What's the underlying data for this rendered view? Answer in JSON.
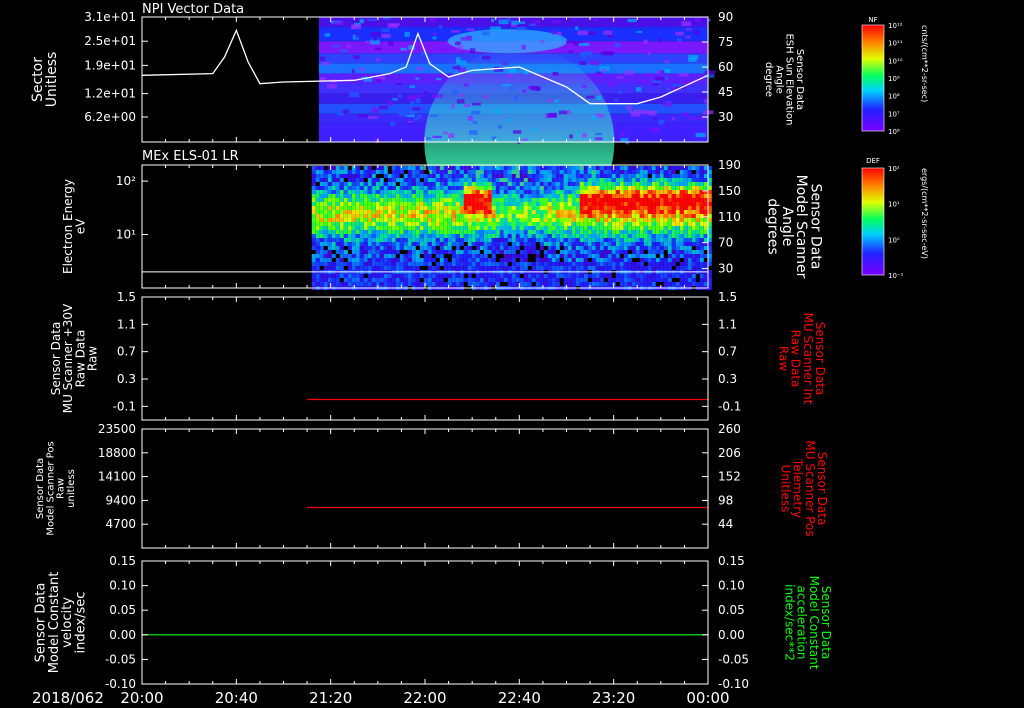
{
  "date_label": "2018/062",
  "time_ticks": [
    "20:00",
    "20:40",
    "21:20",
    "22:00",
    "22:40",
    "23:20",
    "00:00"
  ],
  "colorbars": [
    {
      "tag": "NF",
      "unit": "cnts/(cm**2-sr-sec)",
      "ticks": [
        "10⁸",
        "10⁷",
        "10⁸",
        "10⁹",
        "10¹⁰",
        "10¹¹",
        "10¹²"
      ]
    },
    {
      "tag": "DEF",
      "unit": "ergs/(cm**2-sr-sec-eV)",
      "ticks": [
        "10⁻¹",
        "10⁰",
        "10¹",
        "10²"
      ]
    }
  ],
  "chart_data": [
    {
      "type": "heatmap",
      "title": "NPI Vector Data",
      "ylabel": [
        "Sector",
        "Unitless"
      ],
      "yticks": [
        "3.1e+01",
        "2.5e+01",
        "1.9e+01",
        "1.2e+01",
        "6.2e+00"
      ],
      "ylim": [
        0,
        31
      ],
      "right_ylabel": [
        "Sensor Data",
        "ESH Sun Elevation",
        "Angle",
        "degree"
      ],
      "right_yticks": [
        "90",
        "75",
        "60",
        "45",
        "30"
      ],
      "right_ylim": [
        15,
        90
      ],
      "data_start": "21:15",
      "line_series": {
        "name": "ESH Sun Elevation Angle",
        "unit": "degree",
        "x": [
          "20:00",
          "20:30",
          "20:35",
          "20:40",
          "20:45",
          "20:50",
          "21:00",
          "21:30",
          "21:45",
          "21:52",
          "21:57",
          "22:02",
          "22:10",
          "22:20",
          "22:40",
          "22:45",
          "23:00",
          "23:10",
          "23:30",
          "23:40",
          "00:00"
        ],
        "y": [
          55,
          56,
          66,
          82,
          63,
          50,
          51,
          52,
          56,
          60,
          80,
          62,
          54,
          58,
          60,
          57,
          48,
          38,
          38,
          42,
          55
        ]
      }
    },
    {
      "type": "heatmap",
      "title": "MEx ELS-01 LR",
      "ylabel": [
        "Electron Energy",
        "eV"
      ],
      "yscale": "log",
      "yticks": [
        "10²",
        "10¹"
      ],
      "ylim": [
        1,
        200
      ],
      "right_ylabel": [
        "Sensor Data",
        "Model Scanner",
        "Angle",
        "degrees"
      ],
      "right_yticks": [
        "190",
        "150",
        "110",
        "70",
        "30"
      ],
      "right_ylim": [
        0,
        190
      ],
      "data_start": "21:12",
      "baseline_eV": 2
    },
    {
      "type": "line",
      "ylabel": [
        "Sensor Data",
        "MU Scanner +30V",
        "Raw Data",
        "Raw"
      ],
      "yticks": [
        "1.5",
        "1.1",
        "0.7",
        "0.3",
        "-0.1"
      ],
      "ylim": [
        -0.3,
        1.5
      ],
      "right_ylabel": [
        "Sensor Data",
        "MU Scanner Int",
        "Raw Data",
        "Raw"
      ],
      "right_yticks": [
        "1.5",
        "1.1",
        "0.7",
        "0.3",
        "-0.1"
      ],
      "right_ylim": [
        -0.3,
        1.5
      ],
      "series": [
        {
          "x": [
            "21:10",
            "00:00"
          ],
          "y": [
            0.0,
            0.0
          ],
          "color": "#ff0000"
        }
      ]
    },
    {
      "type": "line",
      "ylabel": [
        "Sensor Data",
        "Model Scanner Pos",
        "Raw",
        "unitless"
      ],
      "yticks": [
        "23500",
        "18800",
        "14100",
        "9400",
        "4700"
      ],
      "ylim": [
        0,
        23500
      ],
      "right_ylabel": [
        "Sensor Data",
        "MU Scanner Pos",
        "Telemetry",
        "Unitless"
      ],
      "right_yticks": [
        "260",
        "206",
        "152",
        "98",
        "44"
      ],
      "right_ylim": [
        -10,
        260
      ],
      "series": [
        {
          "x": [
            "21:10",
            "00:00"
          ],
          "y": [
            8000,
            8000
          ],
          "color": "#ff0000"
        }
      ]
    },
    {
      "type": "line",
      "ylabel": [
        "Sensor Data",
        "Model Constant",
        "velocity",
        "index/sec"
      ],
      "yticks": [
        "0.15",
        "0.10",
        "0.05",
        "0.00",
        "-0.05",
        "-0.10"
      ],
      "ylim": [
        -0.1,
        0.15
      ],
      "right_ylabel": [
        "Sensor Data",
        "Model Constant",
        "acceleration",
        "index/sec**2"
      ],
      "right_yticks": [
        "0.15",
        "0.10",
        "0.05",
        "0.00",
        "-0.05",
        "-0.10"
      ],
      "right_ylim": [
        -0.1,
        0.15
      ],
      "series": [
        {
          "x": [
            "20:00",
            "00:00"
          ],
          "y": [
            0.0,
            0.0
          ],
          "color": "#00ff00"
        }
      ]
    }
  ],
  "colors": {
    "background": "#000000",
    "axis": "#ffffff",
    "right_label_red": "#ff0000",
    "right_label_green": "#00ff00"
  }
}
